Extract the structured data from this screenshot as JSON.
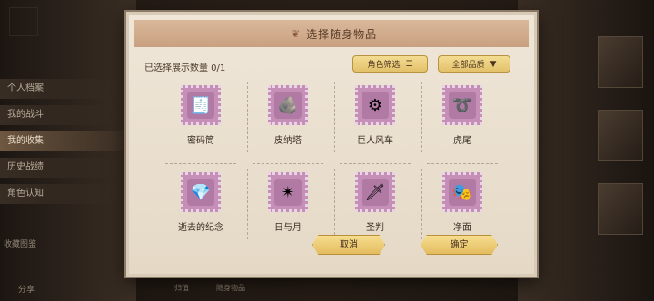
{
  "background": {
    "side_menu": [
      {
        "label": "个人档案",
        "active": false
      },
      {
        "label": "我的战斗",
        "active": false
      },
      {
        "label": "我的收集",
        "active": true
      },
      {
        "label": "历史战绩",
        "active": false
      },
      {
        "label": "角色认知",
        "active": false
      }
    ],
    "gallery_label": "收藏图鉴",
    "share_label": "分享",
    "bottom_tab_1": "归值",
    "bottom_tab_2": "随身物品"
  },
  "dialog": {
    "title": "选择随身物品",
    "selected_count": "已选择展示数量  0/1",
    "filter_role": "角色筛选",
    "filter_quality": "全部品质",
    "items": [
      {
        "name": "密码筒",
        "icon": "cipher-cylinder-icon",
        "glyph": "🧾"
      },
      {
        "name": "皮纳塔",
        "icon": "pinata-icon",
        "glyph": "🪨"
      },
      {
        "name": "巨人风车",
        "icon": "giant-windmill-icon",
        "glyph": "⚙"
      },
      {
        "name": "虎尾",
        "icon": "tiger-tail-icon",
        "glyph": "➰"
      },
      {
        "name": "逝去的纪念",
        "icon": "lost-memento-icon",
        "glyph": "💎"
      },
      {
        "name": "日与月",
        "icon": "sun-moon-mace-icon",
        "glyph": "✴"
      },
      {
        "name": "圣判",
        "icon": "holy-judgment-sword-icon",
        "glyph": "🗡"
      },
      {
        "name": "净面",
        "icon": "clean-mask-icon",
        "glyph": "🎭"
      }
    ],
    "cancel_label": "取消",
    "confirm_label": "确定"
  },
  "colors": {
    "panel_bg": "#efe6d8",
    "title_bar": "#d9b89a",
    "gold_button": "#f6dd8e",
    "stamp_purple": "#c58fb8"
  }
}
